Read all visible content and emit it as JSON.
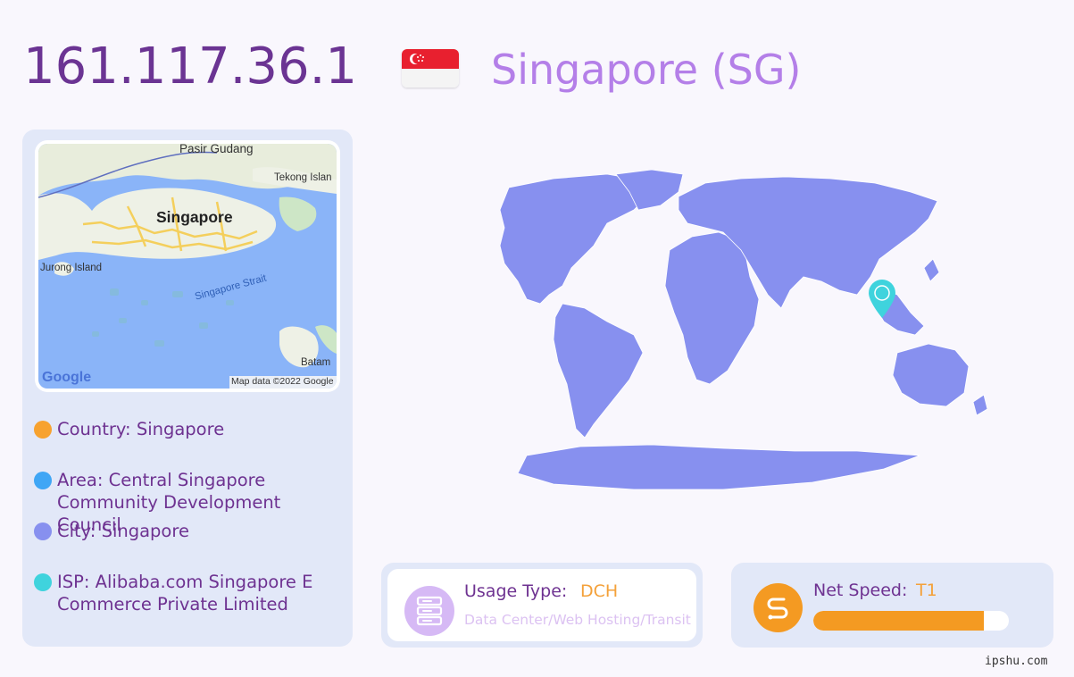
{
  "header": {
    "ip": "161.117.36.1",
    "country_title": "Singapore (SG)"
  },
  "map": {
    "labels": {
      "pasir_gudang": "Pasir Gudang",
      "tekong": "Tekong Islan",
      "singapore": "Singapore",
      "jurong": "Jurong Island",
      "strait": "Singapore Strait",
      "batam": "Batam",
      "google": "Google",
      "attribution": "Map data ©2022 Google"
    }
  },
  "info": {
    "country": "Country: Singapore",
    "area": "Area: Central Singapore Community Development Council",
    "city": "City: Singapore",
    "isp": "ISP: Alibaba.com Singapore E Commerce Private Limited"
  },
  "usage": {
    "label": "Usage Type:",
    "value": "DCH",
    "description": "Data Center/Web Hosting/Transit"
  },
  "speed": {
    "label": "Net Speed:",
    "value": "T1",
    "fill_fraction": 0.87
  },
  "watermark": "ipshu.com",
  "colors": {
    "ip_text": "#6b3493",
    "country_text": "#b47fe8",
    "country_dot": "#f7a22f",
    "area_dot": "#3fa6f5",
    "city_dot": "#8790ef",
    "isp_dot": "#3fd3dd",
    "world_fill": "#8790ef",
    "marker": "#3fd3dd",
    "speed_accent": "#f49a22"
  },
  "icons": {
    "usage": "server-stack-icon",
    "speed": "route-icon",
    "marker": "map-pin-icon"
  }
}
